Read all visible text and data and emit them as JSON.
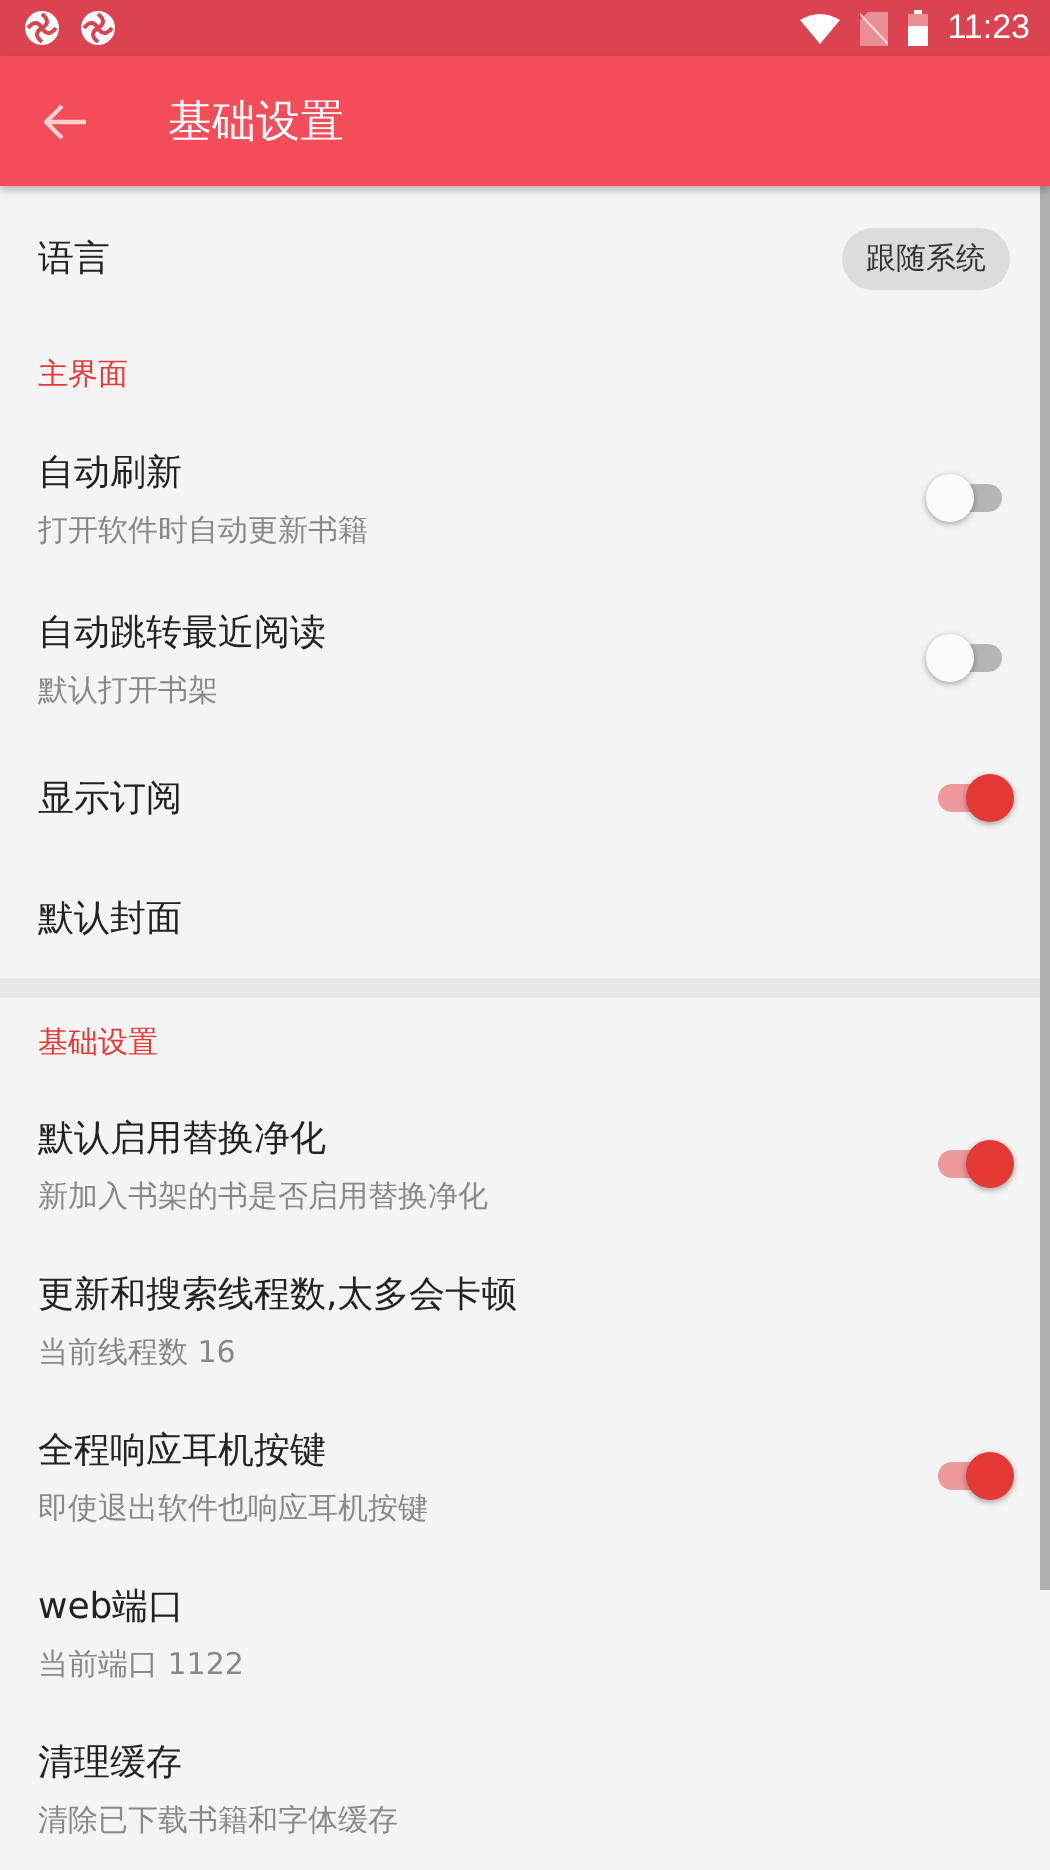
{
  "status_bar": {
    "time": "11:23"
  },
  "toolbar": {
    "title": "基础设置"
  },
  "sections": [
    {
      "items": [
        {
          "kind": "select",
          "title": "语言",
          "value": "跟随系统"
        }
      ]
    },
    {
      "header": "主界面",
      "items": [
        {
          "kind": "toggle",
          "title": "自动刷新",
          "subtitle": "打开软件时自动更新书籍",
          "on": false
        },
        {
          "kind": "toggle",
          "title": "自动跳转最近阅读",
          "subtitle": "默认打开书架",
          "on": false
        },
        {
          "kind": "toggle",
          "title": "显示订阅",
          "on": true
        },
        {
          "kind": "plain",
          "title": "默认封面"
        }
      ]
    },
    {
      "header": "基础设置",
      "items": [
        {
          "kind": "toggle",
          "title": "默认启用替换净化",
          "subtitle": "新加入书架的书是否启用替换净化",
          "on": true
        },
        {
          "kind": "plain",
          "title": "更新和搜索线程数,太多会卡顿",
          "subtitle": "当前线程数 16"
        },
        {
          "kind": "toggle",
          "title": "全程响应耳机按键",
          "subtitle": "即使退出软件也响应耳机按键",
          "on": true
        },
        {
          "kind": "plain",
          "title": "web端口",
          "subtitle": "当前端口 1122"
        },
        {
          "kind": "plain",
          "title": "清理缓存",
          "subtitle": "清除已下载书籍和字体缓存"
        }
      ]
    }
  ]
}
